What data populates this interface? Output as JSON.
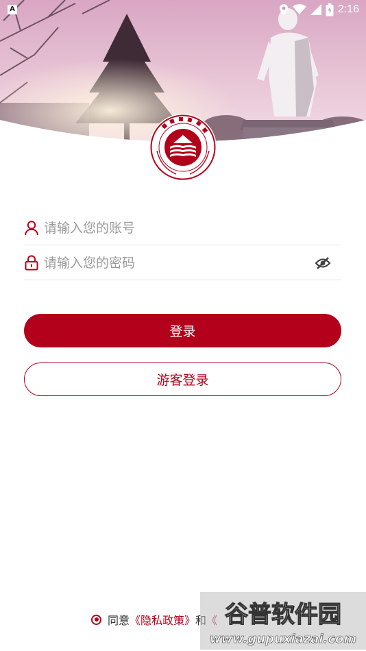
{
  "status_bar": {
    "notification_glyph": "A",
    "time": "2:16",
    "icons": [
      "location-icon",
      "wifi-icon",
      "signal-icon",
      "battery-charging-icon"
    ]
  },
  "logo": {
    "name_cn": "楚雄師範學院",
    "name_en": "CHUXIONG NORMAL UNIVERSITY"
  },
  "form": {
    "account_placeholder": "请输入您的账号",
    "account_value": "",
    "password_placeholder": "请输入您的密码",
    "password_value": "",
    "account_icon": "user-icon",
    "password_icon": "lock-icon",
    "visibility_icon": "eye-off-icon"
  },
  "buttons": {
    "login_label": "登录",
    "guest_label": "游客登录"
  },
  "agreement": {
    "prefix": "同意",
    "privacy_link": "《隐私政策》",
    "conjunction": "和",
    "terms_partial": "《"
  },
  "watermark": {
    "title": "谷普软件园",
    "url": "www.gupuxiazai.com"
  },
  "colors": {
    "brand": "#b3001b",
    "placeholder": "#9a9a9a",
    "divider": "#e6e6e6"
  }
}
